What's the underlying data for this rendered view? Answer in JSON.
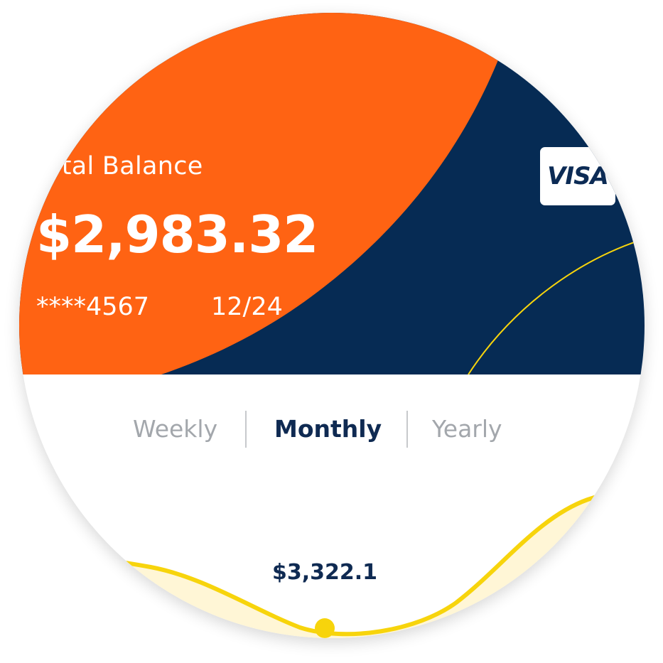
{
  "card": {
    "title": "otal Balance",
    "balance": "$2,983.32",
    "number": "****4567",
    "expiry": "12/24",
    "brand": "VISA"
  },
  "tabs": {
    "weekly": "Weekly",
    "monthly": "Monthly",
    "yearly": "Yearly",
    "selected": "Monthly"
  },
  "chart": {
    "point_value": "$3,322.1"
  },
  "colors": {
    "orange": "#ff6313",
    "navy": "#062b54",
    "yellow": "#f7d40c",
    "yellow_fill": "#fff6d6",
    "active_tab": "#0f2a52",
    "inactive_tab": "#a3a7ac"
  }
}
